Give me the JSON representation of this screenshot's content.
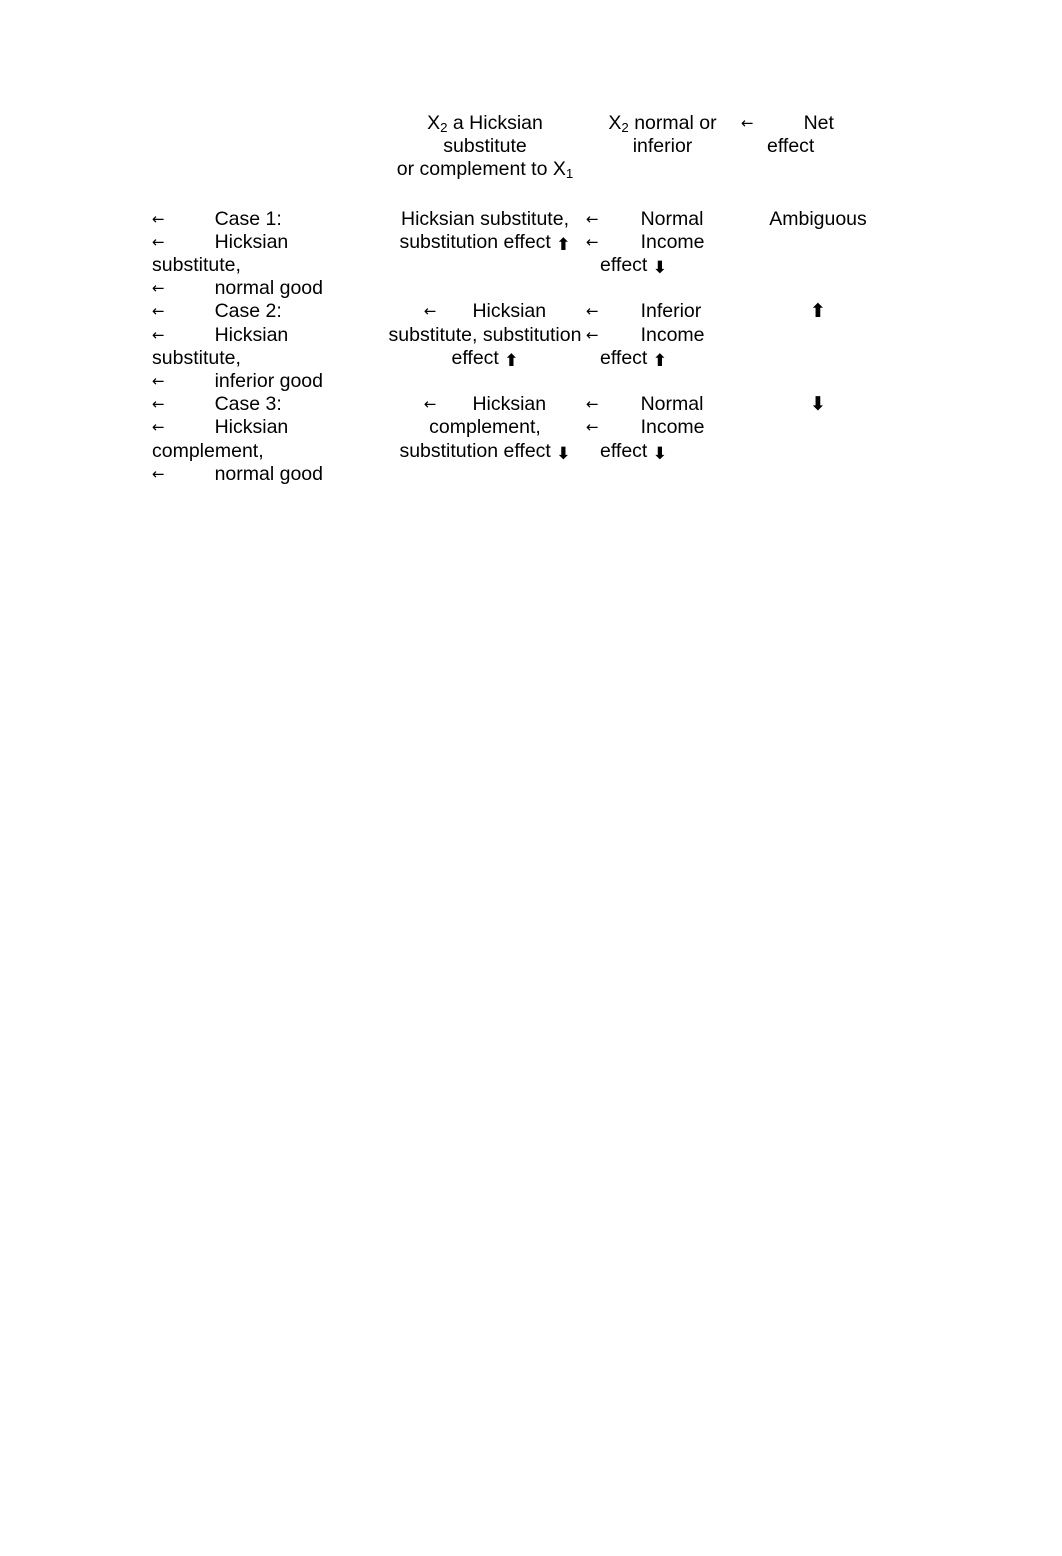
{
  "document": {
    "title": "Hicksian substitute / complement case table",
    "background_color": "#ffffff",
    "text_color": "#000000",
    "list_marker": "←",
    "arrow_up": "⬆",
    "arrow_down": "⬇"
  },
  "table": {
    "headers": {
      "case_column": "",
      "hicksian_column_line1_pre": "X",
      "hicksian_column_line1_sub": "2",
      "hicksian_column_line1_post": " a Hicksian substitute",
      "hicksian_column_line2_pre": "or complement to X",
      "hicksian_column_line2_sub": "1",
      "normal_column_line1_pre": "X",
      "normal_column_line1_sub": "2",
      "normal_column_line1_post": " normal or",
      "normal_column_line2": "inferior",
      "net_column_line1": "Net",
      "net_column_line2": "effect"
    },
    "rows": [
      {
        "case": {
          "line1": "Case 1:",
          "line2": "Hicksian",
          "line3": "substitute,",
          "line4": "normal good"
        },
        "hicksian": {
          "line1": "Hicksian substitute,",
          "line2": "substitution effect",
          "arrow": "⬆"
        },
        "normal": {
          "line1": "Normal",
          "line2": "Income",
          "line3": "effect",
          "arrow": "⬇"
        },
        "net": {
          "text": "Ambiguous",
          "arrow": ""
        }
      },
      {
        "case": {
          "line1": "Case 2:",
          "line2": "Hicksian",
          "line3": "substitute,",
          "line4": "inferior good"
        },
        "hicksian": {
          "line1": "Hicksian",
          "line2": "substitute, substitution",
          "line3": "effect",
          "arrow": "⬆"
        },
        "normal": {
          "line1": "Inferior",
          "line2": "Income",
          "line3": "effect",
          "arrow": "⬆"
        },
        "net": {
          "text": "",
          "arrow": "⬆"
        }
      },
      {
        "case": {
          "line1": "Case 3:",
          "line2": "Hicksian",
          "line3": "complement,",
          "line4": "normal good"
        },
        "hicksian": {
          "line1": "Hicksian",
          "line2": "complement,",
          "line3": "substitution effect",
          "arrow": "⬇"
        },
        "normal": {
          "line1": "Normal",
          "line2": "Income",
          "line3": "effect",
          "arrow": "⬇"
        },
        "net": {
          "text": "",
          "arrow": "⬇"
        }
      }
    ]
  }
}
